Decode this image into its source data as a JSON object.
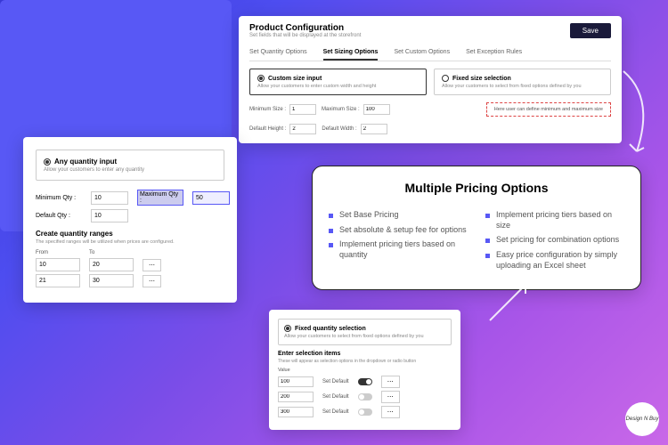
{
  "config": {
    "title": "Product Configuration",
    "subtitle": "Set fields that will be displayed at the storefront",
    "save": "Save",
    "tabs": [
      "Set Quantity Options",
      "Set Sizing Options",
      "Set Custom Options",
      "Set Exception Rules"
    ],
    "opt_custom": {
      "title": "Custom size input",
      "desc": "Allow your customers to enter custom width and height"
    },
    "opt_fixed": {
      "title": "Fixed size selection",
      "desc": "Allow your customers to select from fixed options defined by you"
    },
    "fields": {
      "min_size_l": "Minimum Size :",
      "min_size": "1",
      "max_size_l": "Maximum Size :",
      "max_size": "100",
      "def_h_l": "Default Height :",
      "def_h": "2",
      "def_w_l": "Default Width :",
      "def_w": "2"
    },
    "hint": "Here user can define minimum and maximum size"
  },
  "qty": {
    "opt_title": "Any quantity input",
    "opt_desc": "Allow your customers to enter any quantity",
    "min_l": "Minimum Qty :",
    "min": "10",
    "max_l": "Maximum Qty :",
    "max": "50",
    "def_l": "Default Qty :",
    "def": "10",
    "ranges_title": "Create quantity ranges",
    "ranges_note": "The specified ranges will be utilized when prices are configured.",
    "from": "From",
    "to": "To",
    "rows": [
      {
        "f": "10",
        "t": "20"
      },
      {
        "f": "21",
        "t": "30"
      }
    ]
  },
  "pricing": {
    "title": "Multiple Pricing Options",
    "left": [
      "Set Base Pricing",
      "Set absolute & setup fee for options",
      "Implement pricing tiers based on quantity"
    ],
    "right": [
      "Implement pricing tiers based on size",
      "Set pricing for combination options",
      "Easy price configuration by simply uploading an Excel sheet"
    ]
  },
  "fixed": {
    "opt_title": "Fixed quantity selection",
    "opt_desc": "Allow your customers to select from fixed options defined by you",
    "sub": "Enter selection items",
    "note": "These will appear as selection options in the dropdown or radio button",
    "hdr": "Value",
    "setdef": "Set Default",
    "rows": [
      "100",
      "200",
      "300"
    ]
  },
  "logo": "Design N Buy"
}
